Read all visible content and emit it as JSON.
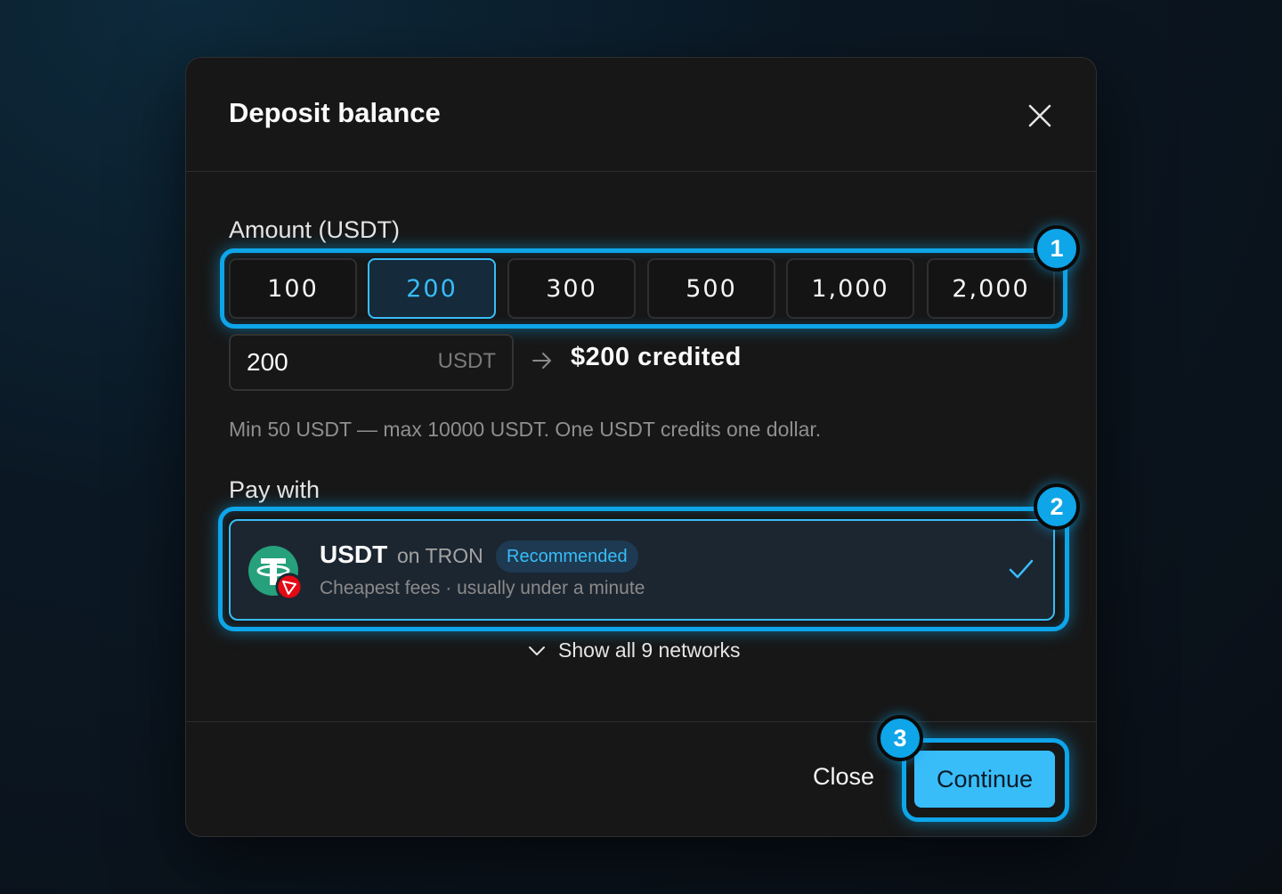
{
  "modal": {
    "title": "Deposit balance"
  },
  "amount": {
    "label": "Amount (USDT)",
    "presets": [
      "100",
      "200",
      "300",
      "500",
      "1,000",
      "2,000"
    ],
    "selected": "200",
    "input_value": "200",
    "input_unit": "USDT",
    "credited_text": "$200 credited",
    "hint": "Min 50 USDT — max 10000 USDT. One USDT credits one dollar."
  },
  "pay": {
    "label": "Pay with",
    "network": {
      "token": "USDT",
      "chain": "on TRON",
      "badge": "Recommended",
      "subtitle": "Cheapest fees · usually under a minute",
      "selected": true
    },
    "show_all": "Show all 9 networks"
  },
  "footer": {
    "close_label": "Close",
    "continue_label": "Continue"
  },
  "step_badges": [
    "1",
    "2",
    "3"
  ],
  "colors": {
    "accent": "#0ea5e9",
    "accent_light": "#38bdf8",
    "tether_green": "#26a17b",
    "tron_red": "#e50914"
  },
  "icons": {
    "close": "close-icon",
    "arrow": "arrow-right-icon",
    "check": "check-icon",
    "chevron": "chevron-down-icon",
    "token": "tether-icon",
    "chain": "tron-icon"
  }
}
